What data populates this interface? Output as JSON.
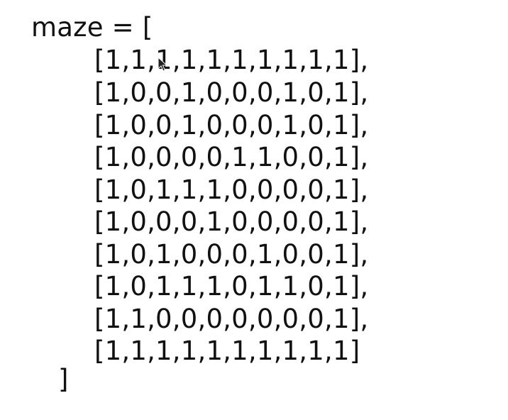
{
  "code": {
    "header": "maze = [",
    "rows": [
      "[1,1,1,1,1,1,1,1,1,1],",
      "[1,0,0,1,0,0,0,1,0,1],",
      "[1,0,0,1,0,0,0,1,0,1],",
      "[1,0,0,0,0,1,1,0,0,1],",
      "[1,0,1,1,1,0,0,0,0,1],",
      "[1,0,0,0,1,0,0,0,0,1],",
      "[1,0,1,0,0,0,1,0,0,1],",
      "[1,0,1,1,1,0,1,1,0,1],",
      "[1,1,0,0,0,0,0,0,0,1],",
      "[1,1,1,1,1,1,1,1,1,1]"
    ],
    "closing": "]"
  }
}
